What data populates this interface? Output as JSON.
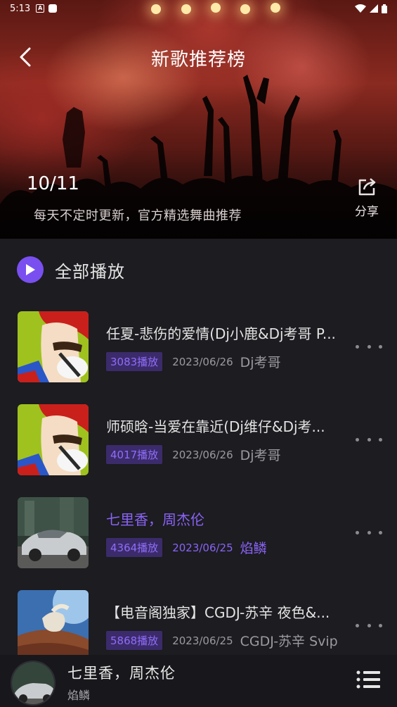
{
  "status_bar": {
    "time": "5:13"
  },
  "header": {
    "title": "新歌推荐榜",
    "date": "10/11",
    "description": "每天不定时更新，官方精选舞曲推荐",
    "share_label": "分享"
  },
  "play_all": {
    "label": "全部播放"
  },
  "songs": [
    {
      "title": "任夏-悲伤的爱情(Dj小鹿&Dj考哥 P...",
      "plays": "3083播放",
      "date": "2023/06/26",
      "author": "Dj考哥",
      "cover": "cartoon-shaving-man",
      "active": false
    },
    {
      "title": "师硕晗-当爱在靠近(Dj维仔&Dj考...",
      "plays": "4017播放",
      "date": "2023/06/26",
      "author": "Dj考哥",
      "cover": "cartoon-shaving-man",
      "active": false
    },
    {
      "title": "七里香，周杰伦",
      "plays": "4364播放",
      "date": "2023/06/25",
      "author": "焰鳞",
      "cover": "silver-car-night",
      "active": true
    },
    {
      "title": "【电音阁独家】CGDJ-苏辛 夜色&...",
      "plays": "5868播放",
      "date": "2023/06/25",
      "author": "CGDJ-苏辛 Svip",
      "cover": "astronaut-space",
      "active": false
    }
  ],
  "player": {
    "title": "七里香，周杰伦",
    "artist": "焰鳞"
  },
  "colors": {
    "accent": "#8a63f5",
    "badge_bg": "#3b2b6b",
    "background": "#1c1c21",
    "player_bg": "#18181c"
  }
}
